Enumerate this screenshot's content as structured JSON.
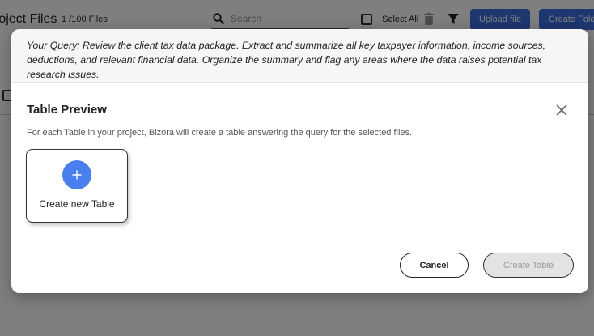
{
  "background": {
    "page_title": "roject Files",
    "file_count": "1 /100 Files",
    "search": {
      "placeholder": "Search"
    },
    "select_all_label": "Select All",
    "upload_label": "Upload file",
    "create_folder_label": "Create Fold",
    "icons": {
      "search": "search-icon",
      "trash": "trash-icon",
      "filter": "filter-icon"
    }
  },
  "modal": {
    "query_text": "Your Query: Review the client tax data package. Extract and summarize all key taxpayer information, income sources, deductions, and relevant financial data. Organize the summary and flag any areas where the data raises potential tax research issues.",
    "title": "Table Preview",
    "description": "For each Table in your project, Bizora will create a table answering the query for the selected files.",
    "create_card_label": "Create new Table",
    "cancel_label": "Cancel",
    "create_table_label": "Create Table",
    "icons": {
      "close": "close-icon",
      "plus": "plus-icon"
    }
  },
  "colors": {
    "accent": "#3d6fe0",
    "plus_circle": "#4a7ff0",
    "disabled_bg": "#e3e3e3",
    "disabled_text": "#999999"
  }
}
